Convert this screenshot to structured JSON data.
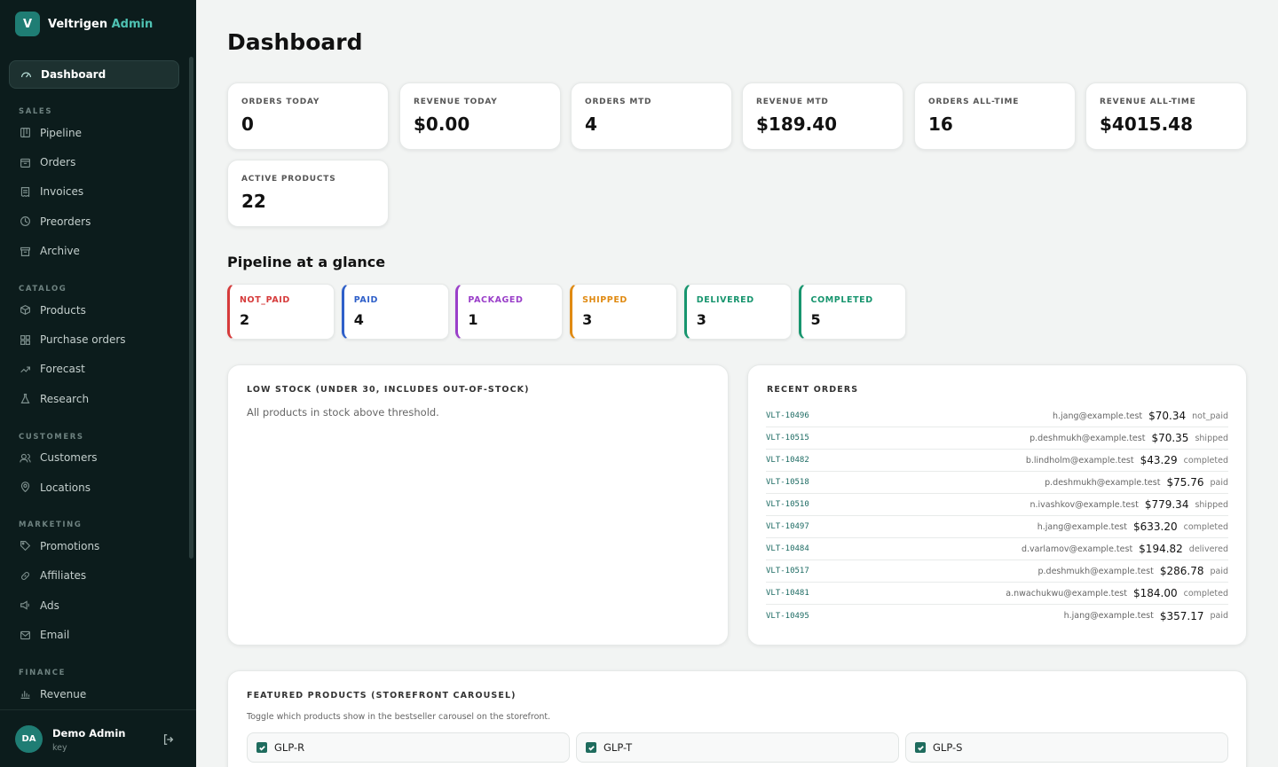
{
  "brand": {
    "logo_letter": "V",
    "name": "Veltrigen",
    "accent": "Admin"
  },
  "sidebar": {
    "active": {
      "label": "Dashboard",
      "icon": "gauge-icon"
    },
    "sections": [
      {
        "title": "SALES",
        "items": [
          {
            "label": "Pipeline",
            "icon": "kanban-icon"
          },
          {
            "label": "Orders",
            "icon": "box-icon"
          },
          {
            "label": "Invoices",
            "icon": "receipt-icon"
          },
          {
            "label": "Preorders",
            "icon": "clock-icon"
          },
          {
            "label": "Archive",
            "icon": "archive-icon"
          }
        ]
      },
      {
        "title": "CATALOG",
        "items": [
          {
            "label": "Products",
            "icon": "package-icon"
          },
          {
            "label": "Purchase orders",
            "icon": "grid-icon"
          },
          {
            "label": "Forecast",
            "icon": "trend-icon"
          },
          {
            "label": "Research",
            "icon": "flask-icon"
          }
        ]
      },
      {
        "title": "CUSTOMERS",
        "items": [
          {
            "label": "Customers",
            "icon": "users-icon"
          },
          {
            "label": "Locations",
            "icon": "pin-icon"
          }
        ]
      },
      {
        "title": "MARKETING",
        "items": [
          {
            "label": "Promotions",
            "icon": "tag-icon"
          },
          {
            "label": "Affiliates",
            "icon": "link-icon"
          },
          {
            "label": "Ads",
            "icon": "megaphone-icon"
          },
          {
            "label": "Email",
            "icon": "mail-icon"
          }
        ]
      },
      {
        "title": "FINANCE",
        "items": [
          {
            "label": "Revenue",
            "icon": "bar-chart-icon"
          }
        ]
      }
    ]
  },
  "user": {
    "initials": "DA",
    "name": "Demo Admin",
    "sub": "key"
  },
  "page": {
    "title": "Dashboard"
  },
  "stats": [
    {
      "label": "ORDERS TODAY",
      "value": "0"
    },
    {
      "label": "REVENUE TODAY",
      "value": "$0.00"
    },
    {
      "label": "ORDERS MTD",
      "value": "4"
    },
    {
      "label": "REVENUE MTD",
      "value": "$189.40"
    },
    {
      "label": "ORDERS ALL-TIME",
      "value": "16"
    },
    {
      "label": "REVENUE ALL-TIME",
      "value": "$4015.48"
    },
    {
      "label": "ACTIVE PRODUCTS",
      "value": "22"
    }
  ],
  "pipeline": {
    "title": "Pipeline at a glance",
    "stages": [
      {
        "label": "NOT_PAID",
        "value": "2",
        "color": "#d63b3b"
      },
      {
        "label": "PAID",
        "value": "4",
        "color": "#2e5fc9"
      },
      {
        "label": "PACKAGED",
        "value": "1",
        "color": "#9a3fc9"
      },
      {
        "label": "SHIPPED",
        "value": "3",
        "color": "#e08a12"
      },
      {
        "label": "DELIVERED",
        "value": "3",
        "color": "#17956e"
      },
      {
        "label": "COMPLETED",
        "value": "5",
        "color": "#17956e"
      }
    ]
  },
  "low_stock": {
    "title": "LOW STOCK (UNDER 30, INCLUDES OUT-OF-STOCK)",
    "message": "All products in stock above threshold."
  },
  "recent_orders": {
    "title": "RECENT ORDERS",
    "rows": [
      {
        "id": "VLT-10496",
        "email": "h.jang@example.test",
        "amount": "$70.34",
        "status": "not_paid"
      },
      {
        "id": "VLT-10515",
        "email": "p.deshmukh@example.test",
        "amount": "$70.35",
        "status": "shipped"
      },
      {
        "id": "VLT-10482",
        "email": "b.lindholm@example.test",
        "amount": "$43.29",
        "status": "completed"
      },
      {
        "id": "VLT-10518",
        "email": "p.deshmukh@example.test",
        "amount": "$75.76",
        "status": "paid"
      },
      {
        "id": "VLT-10510",
        "email": "n.ivashkov@example.test",
        "amount": "$779.34",
        "status": "shipped"
      },
      {
        "id": "VLT-10497",
        "email": "h.jang@example.test",
        "amount": "$633.20",
        "status": "completed"
      },
      {
        "id": "VLT-10484",
        "email": "d.varlamov@example.test",
        "amount": "$194.82",
        "status": "delivered"
      },
      {
        "id": "VLT-10517",
        "email": "p.deshmukh@example.test",
        "amount": "$286.78",
        "status": "paid"
      },
      {
        "id": "VLT-10481",
        "email": "a.nwachukwu@example.test",
        "amount": "$184.00",
        "status": "completed"
      },
      {
        "id": "VLT-10495",
        "email": "h.jang@example.test",
        "amount": "$357.17",
        "status": "paid"
      }
    ]
  },
  "featured": {
    "title": "FEATURED PRODUCTS (STOREFRONT CAROUSEL)",
    "subtitle": "Toggle which products show in the bestseller carousel on the storefront.",
    "products": [
      {
        "label": "GLP-R",
        "checked": true
      },
      {
        "label": "GLP-T",
        "checked": true
      },
      {
        "label": "GLP-S",
        "checked": true
      }
    ]
  }
}
